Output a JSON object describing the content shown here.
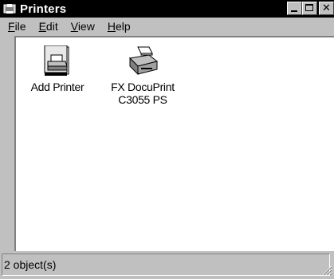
{
  "window": {
    "title": "Printers",
    "icon": "printers-folder-icon",
    "buttons": [
      "minimize",
      "maximize",
      "close"
    ],
    "close_glyph": "✕"
  },
  "menu": {
    "file_first": "F",
    "file_rest": "ile",
    "edit_first": "E",
    "edit_rest": "dit",
    "view_first": "V",
    "view_rest": "iew",
    "help_first": "H",
    "help_rest": "elp"
  },
  "items": [
    {
      "label_line1": "Add Printer",
      "label_line2": "",
      "icon": "add-printer-icon"
    },
    {
      "label_line1": "FX DocuPrint",
      "label_line2": "C3055 PS",
      "icon": "printer-icon"
    }
  ],
  "status": {
    "text": "2 object(s)"
  }
}
